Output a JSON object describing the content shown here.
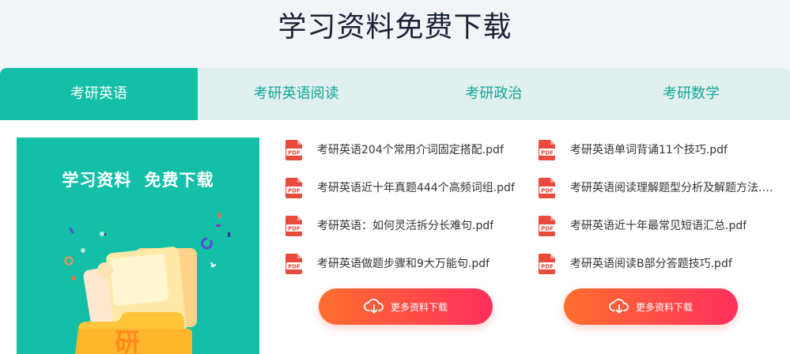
{
  "header": {
    "title": "学习资料免费下载"
  },
  "tabs": [
    {
      "label": "考研英语",
      "active": true
    },
    {
      "label": "考研英语阅读"
    },
    {
      "label": "考研政治"
    },
    {
      "label": "考研数学"
    }
  ],
  "promo": {
    "text": "学习资料  免费下载",
    "folder_char": "研"
  },
  "files": {
    "left": [
      "考研英语204个常用介词固定搭配.pdf",
      "考研英语近十年真题444个高频词组.pdf",
      "考研英语：如何灵活拆分长难句.pdf",
      "考研英语做题步骤和9大万能句.pdf"
    ],
    "right": [
      "考研英语单词背诵11个技巧.pdf",
      "考研英语阅读理解题型分析及解题方法.pdf",
      "考研英语近十年最常见短语汇总.pdf",
      "考研英语阅读B部分答题技巧.pdf"
    ]
  },
  "pdf_icon_label": "PDF",
  "buttons": {
    "more_left": "更多资料下载",
    "more_right": "更多资料下载"
  },
  "colors": {
    "teal": "#13bfa6",
    "tab_bg": "#dff0ee",
    "pdf_red": "#e84b3c",
    "btn_from": "#ff6f2e",
    "btn_to": "#ff2f5c"
  }
}
